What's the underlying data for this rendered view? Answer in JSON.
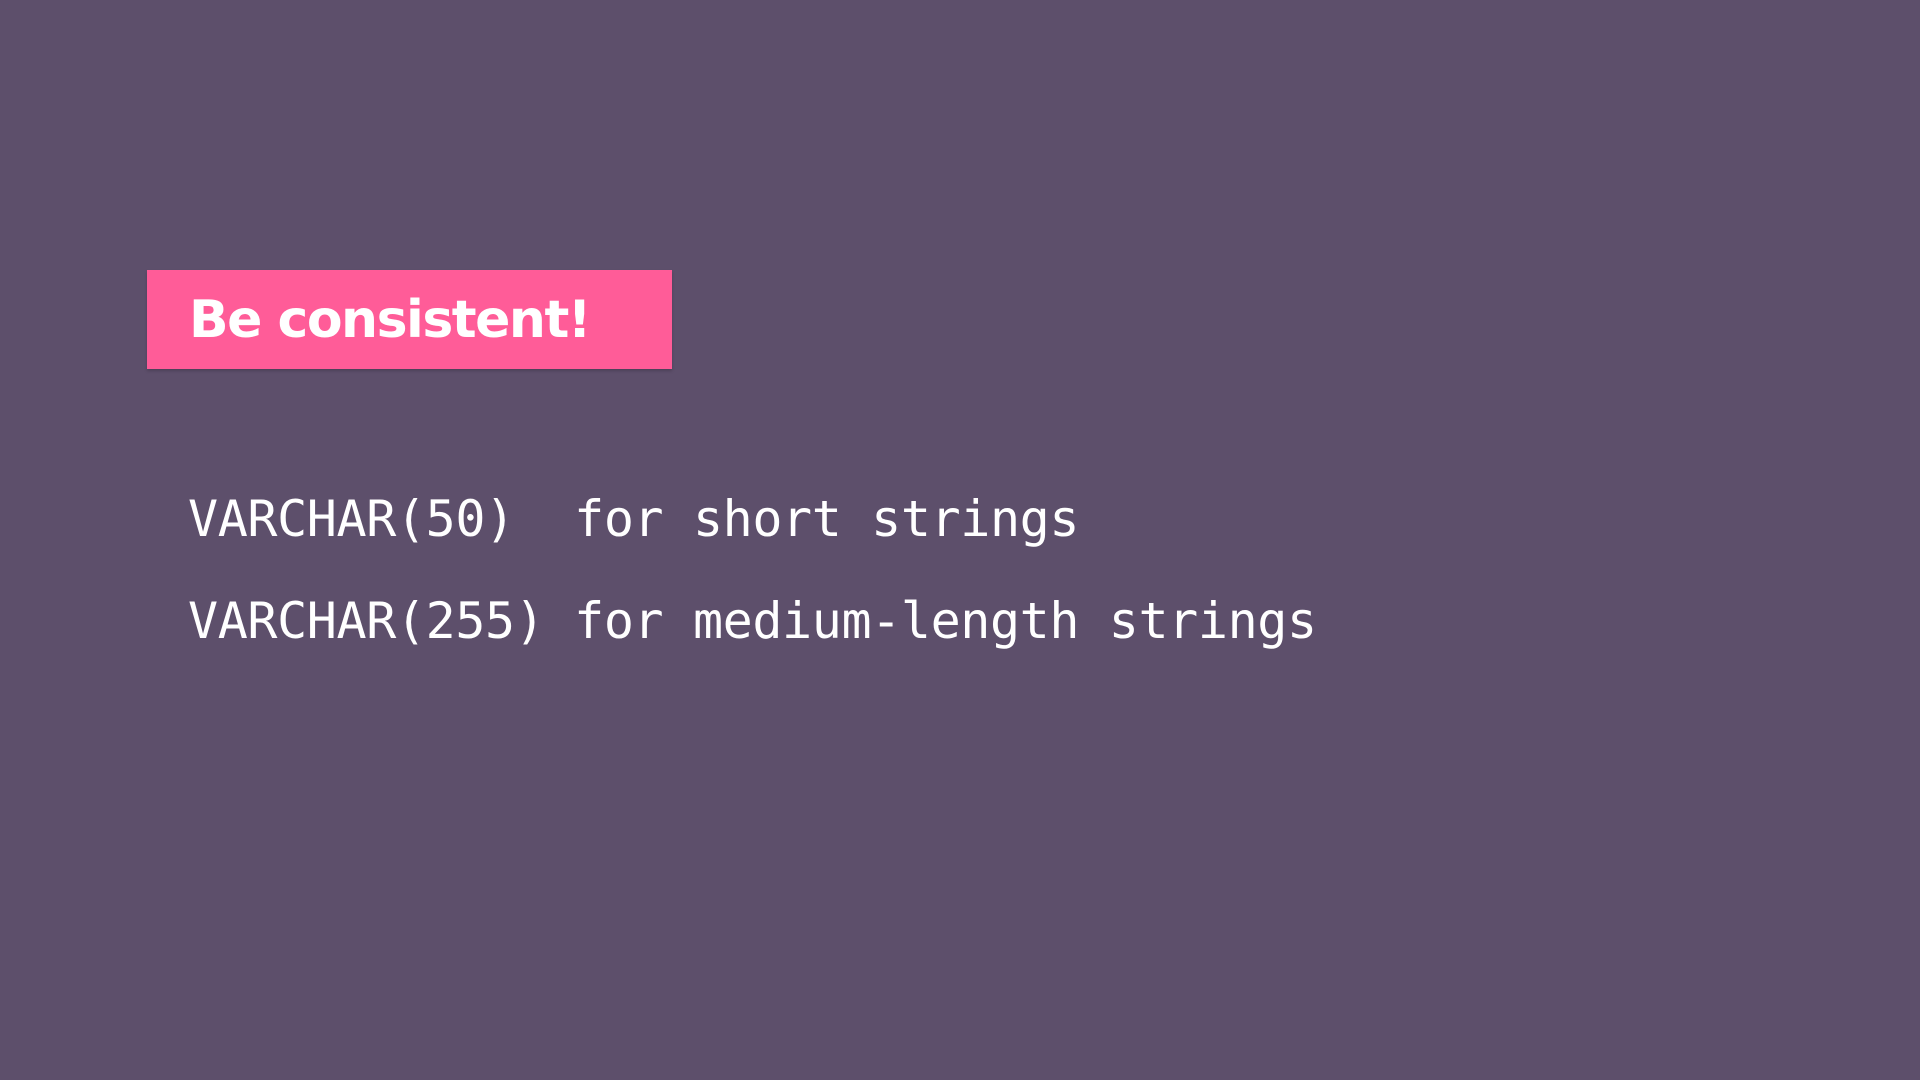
{
  "slide": {
    "background_color": "#5d4f6b",
    "title": {
      "text": "Be consistent!",
      "background_color": "#ff5c98",
      "text_color": "#ffffff"
    },
    "lines": [
      "VARCHAR(50)  for short strings",
      "VARCHAR(255) for medium-length strings"
    ]
  }
}
